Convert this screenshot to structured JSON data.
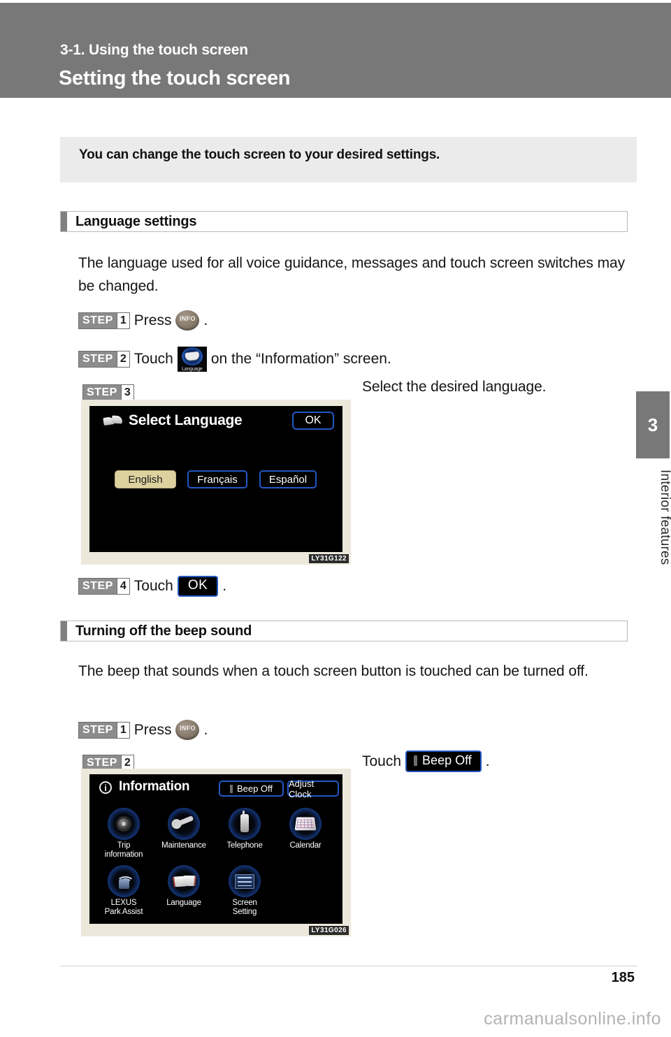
{
  "header": {
    "section_label": "3-1. Using the touch screen",
    "title": "Setting the touch screen"
  },
  "chapter_tab": {
    "number": "3",
    "label": "Interior features"
  },
  "intro": {
    "text": "You can change the touch screen to your desired settings."
  },
  "sections": [
    {
      "title": "Language settings",
      "paragraph": "The language used for all voice guidance, messages and touch screen switches may be changed.",
      "steps": [
        {
          "word": "STEP",
          "num": "1",
          "pre": "Press",
          "post": "."
        },
        {
          "word": "STEP",
          "num": "2",
          "pre": "Touch",
          "post": "on the “Information” screen."
        },
        {
          "word": "STEP",
          "num": "3",
          "caption": "Select the desired language."
        },
        {
          "word": "STEP",
          "num": "4",
          "pre": "Touch",
          "post": "."
        }
      ]
    },
    {
      "title": "Turning off the beep sound",
      "paragraph": "The beep that sounds when a touch screen button is touched can be turned off.",
      "steps": [
        {
          "word": "STEP",
          "num": "1",
          "pre": "Press",
          "post": "."
        },
        {
          "word": "STEP",
          "num": "2",
          "caption_pre": "Touch",
          "caption_post": "."
        }
      ]
    }
  ],
  "buttons": {
    "info_hard_button": "INFO",
    "language_tile_label": "Language",
    "ok_inline": "OK",
    "beep_off_inline": "Beep Off"
  },
  "figure_select_language": {
    "id": "LY31G122",
    "title": "Select Language",
    "ok_label": "OK",
    "options": [
      {
        "label": "English",
        "selected": true
      },
      {
        "label": "Français",
        "selected": false
      },
      {
        "label": "Español",
        "selected": false
      }
    ]
  },
  "figure_information": {
    "id": "LY31G026",
    "title": "Information",
    "top_buttons": [
      {
        "label": "Beep Off",
        "has_bar": true
      },
      {
        "label": "Adjust Clock",
        "has_bar": false
      }
    ],
    "menu": [
      {
        "label": "Trip\ninformation",
        "icon": "tire-wheel-icon"
      },
      {
        "label": "Maintenance",
        "icon": "wrench-icon"
      },
      {
        "label": "Telephone",
        "icon": "phone-handset-icon"
      },
      {
        "label": "Calendar",
        "icon": "calendar-icon"
      },
      {
        "label": "LEXUS\nPark  Assist",
        "icon": "park-assist-icon"
      },
      {
        "label": "Language",
        "icon": "book-icon"
      },
      {
        "label": "Screen\nSetting",
        "icon": "screen-list-icon"
      }
    ]
  },
  "footer": {
    "page_number": "185",
    "watermark": "carmanualsonline.info"
  },
  "colors": {
    "header_gray": "#787878",
    "intro_gray": "#ebebeb",
    "nav_blue": "#2358c6",
    "selected_tan": "#ddd1a0",
    "figure_bg": "#ece8db"
  }
}
